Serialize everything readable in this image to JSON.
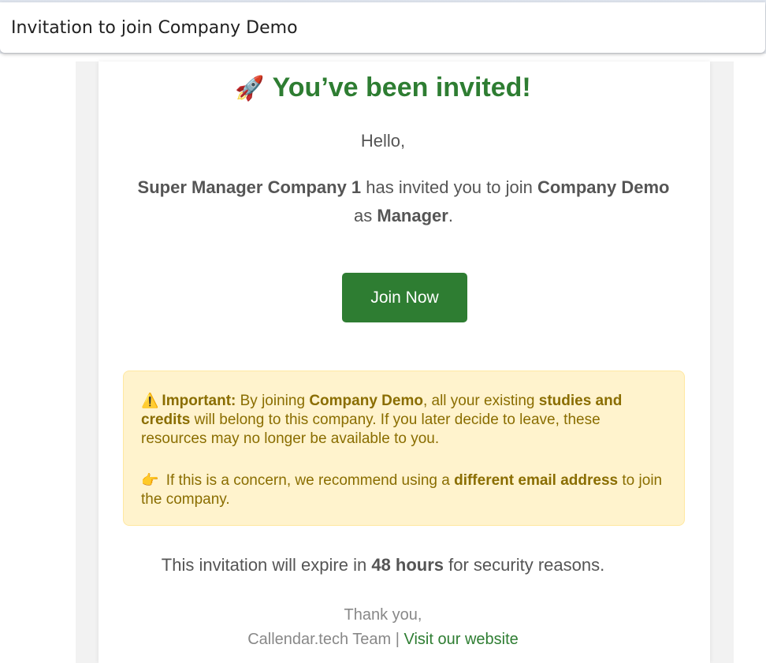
{
  "subject": "Invitation to join Company Demo",
  "heading": {
    "icon": "rocket-icon",
    "text": "You’ve been invited!"
  },
  "greeting": "Hello,",
  "invite": {
    "inviter": "Super Manager Company 1",
    "text1": " has invited you to join ",
    "company": "Company Demo",
    "text2": " as ",
    "role": "Manager",
    "text3": "."
  },
  "join_button": "Join Now",
  "warning": {
    "icon": "warning-icon",
    "label": "Important:",
    "text1": " By joining ",
    "company": "Company Demo",
    "text2": ", all your existing ",
    "resources": "studies and credits",
    "text3": " will belong to this company. If you later decide to leave, these resources may no longer be available to you.",
    "tip_icon": "pointing-hand-icon",
    "tip_text1": " If this is a concern, we recommend using a ",
    "tip_bold": "different email address",
    "tip_text2": " to join the company."
  },
  "expire": {
    "text1": "This invitation will expire in ",
    "duration": "48 hours",
    "text2": " for security reasons."
  },
  "thanks": "Thank you,",
  "signature": {
    "team": "Callendar.tech Team",
    "separator": " | ",
    "link": "Visit our website"
  },
  "colors": {
    "accent": "#2e7d32",
    "warning_bg": "#fff3cd",
    "warning_text": "#8a6d00",
    "body_text": "#555555"
  }
}
